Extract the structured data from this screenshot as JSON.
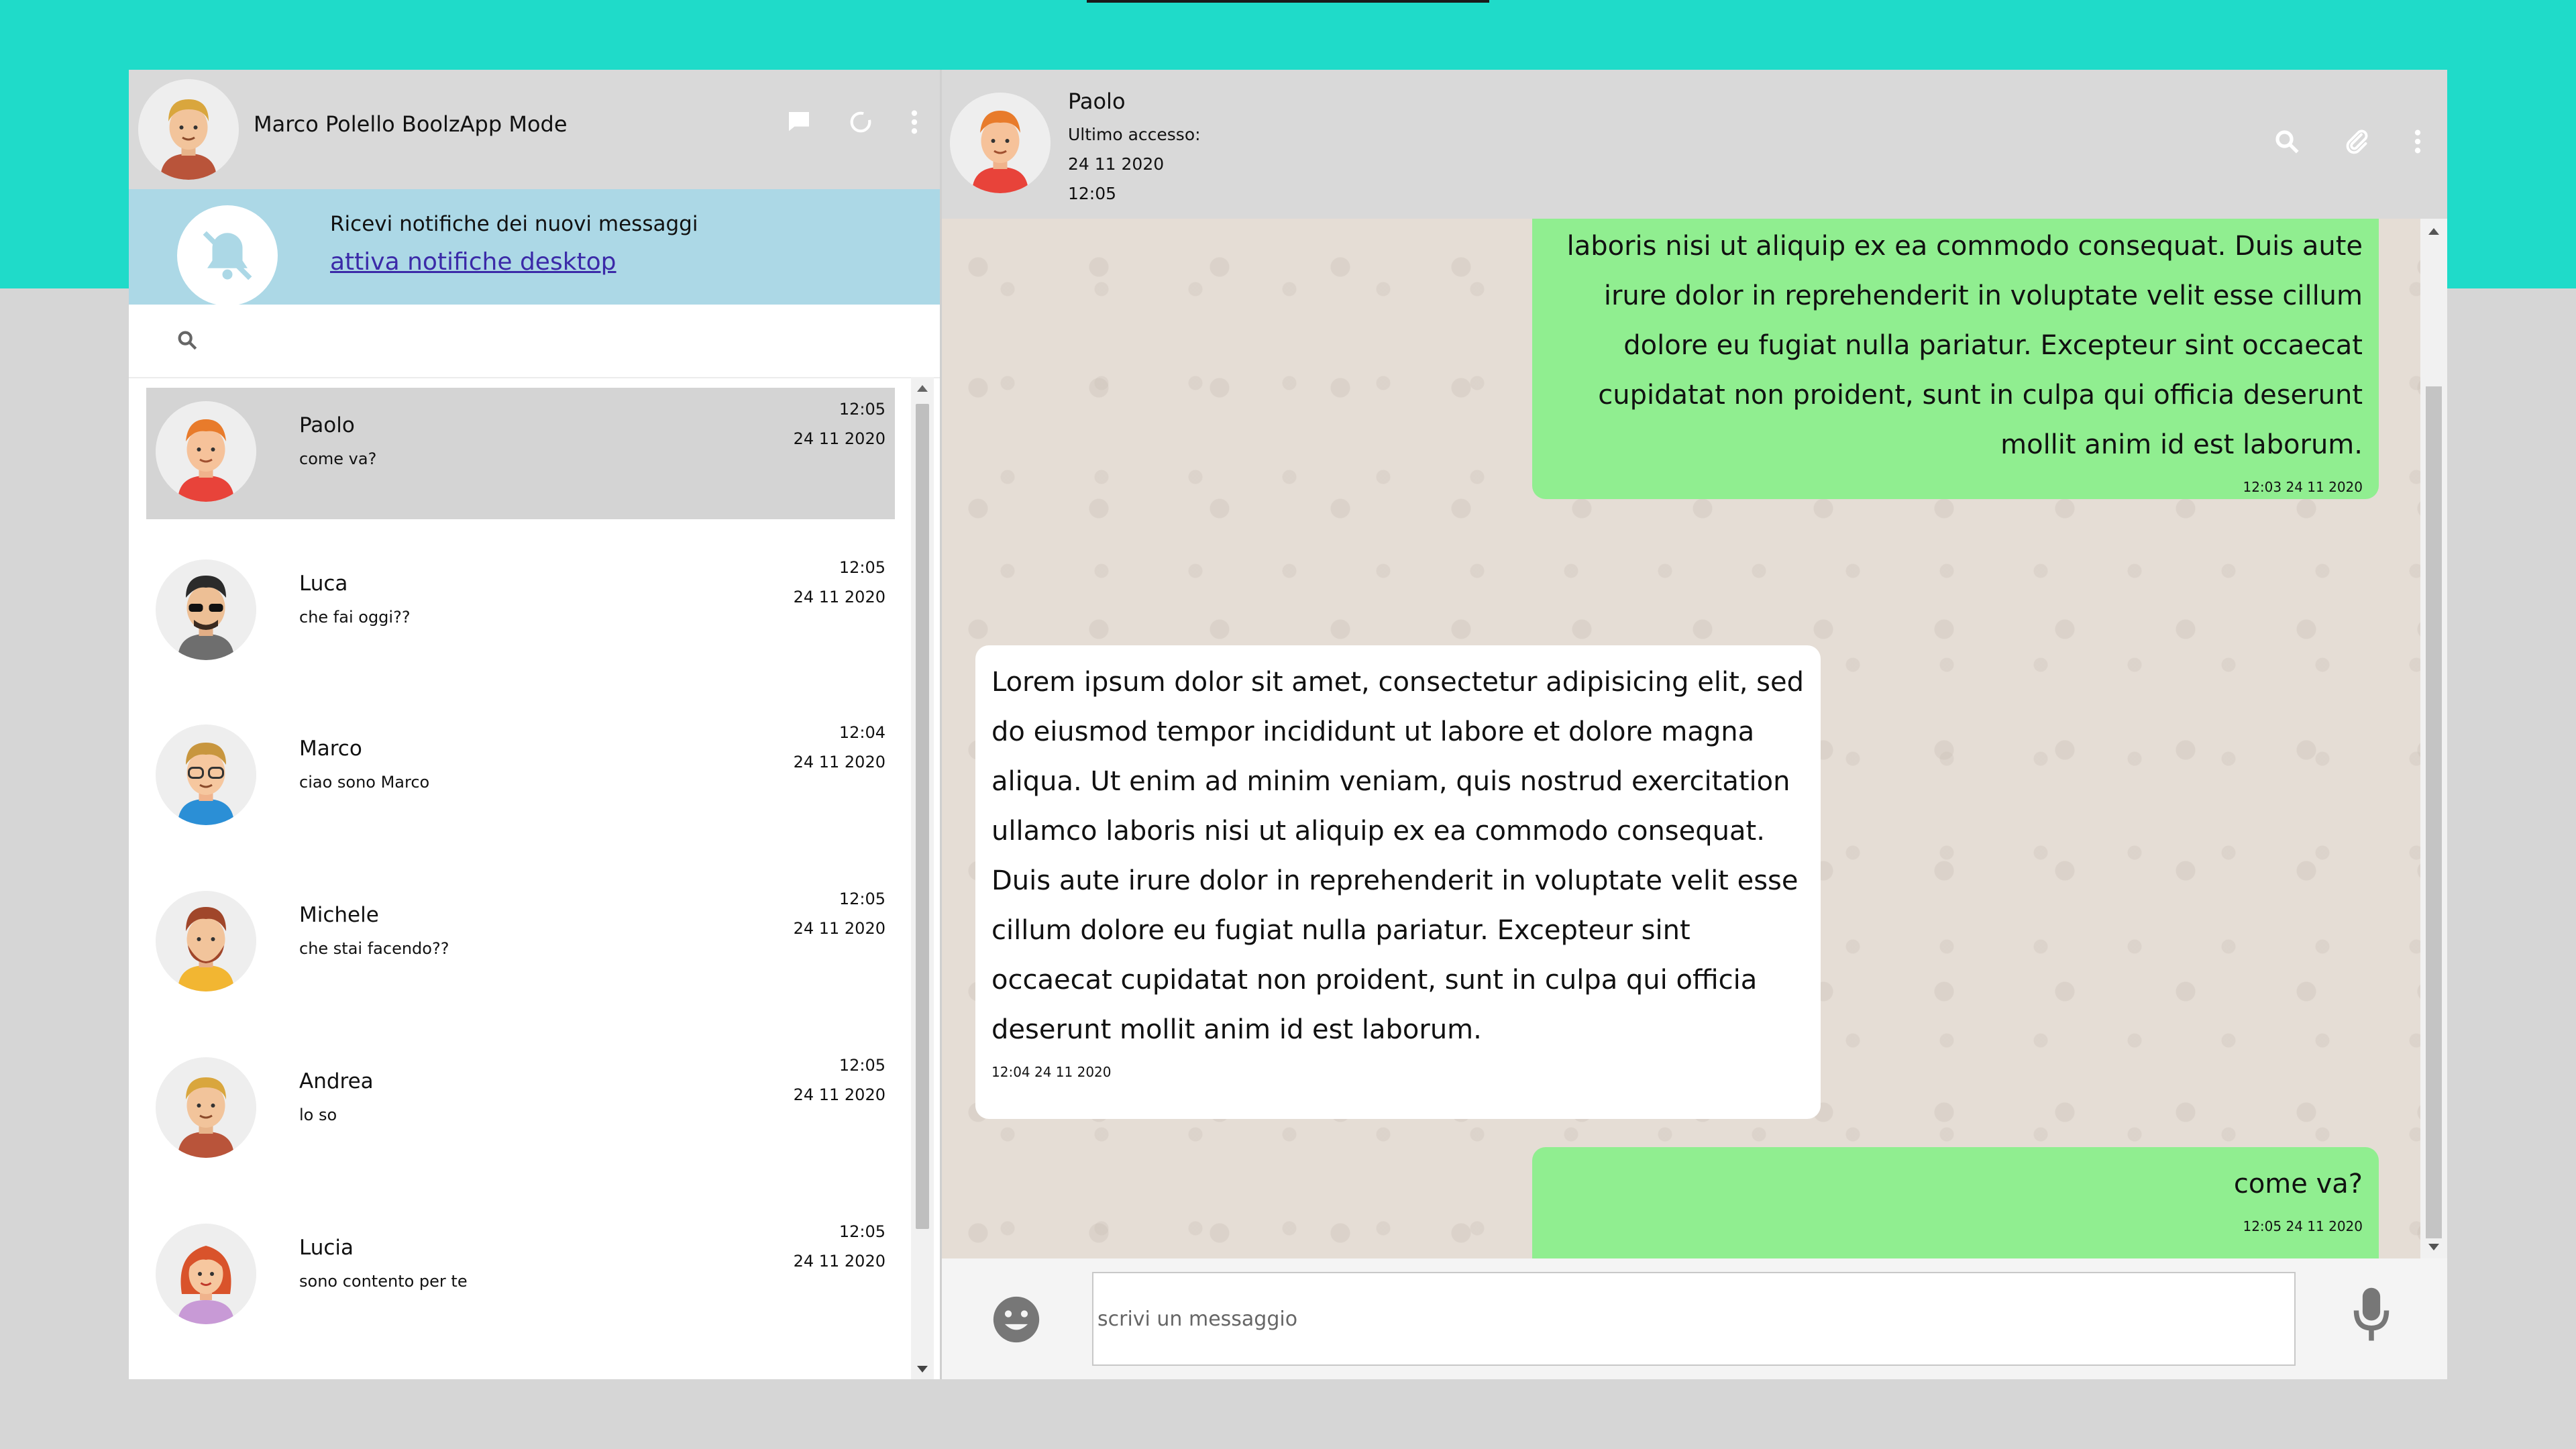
{
  "me": {
    "name": "Marco Polello BoolzApp Mode"
  },
  "header_icons": [
    "chat-icon",
    "status-icon",
    "menu-dots-icon"
  ],
  "notification": {
    "title": "Ricevi notifiche dei nuovi messaggi",
    "link": "attiva notifiche desktop"
  },
  "search": {
    "placeholder": ""
  },
  "contacts": [
    {
      "name": "Paolo",
      "last": "come va?",
      "time": "12:05",
      "date": "24 11 2020",
      "active": true
    },
    {
      "name": "Luca",
      "last": "che fai oggi??",
      "time": "12:05",
      "date": "24 11 2020"
    },
    {
      "name": "Marco",
      "last": "ciao sono Marco",
      "time": "12:04",
      "date": "24 11 2020"
    },
    {
      "name": "Michele",
      "last": "che stai facendo??",
      "time": "12:05",
      "date": "24 11 2020"
    },
    {
      "name": "Andrea",
      "last": "lo so",
      "time": "12:05",
      "date": "24 11 2020"
    },
    {
      "name": "Lucia",
      "last": "sono contento per te",
      "time": "12:05",
      "date": "24 11 2020"
    }
  ],
  "chat": {
    "name": "Paolo",
    "status_label": "Ultimo accesso:",
    "last_seen_date": "24 11 2020",
    "last_seen_time": "12:05",
    "messages": [
      {
        "type": "sent",
        "text": "enim ad minim veniam, quis nostrud exercitation ullamco laboris nisi ut aliquip ex ea commodo consequat. Duis aute irure dolor in reprehenderit in voluptate velit esse cillum dolore eu fugiat nulla pariatur. Excepteur sint occaecat cupidatat non proident, sunt in culpa qui officia deserunt mollit anim id est laborum.",
        "time": "12:03 24 11 2020"
      },
      {
        "type": "received",
        "text": "Lorem ipsum dolor sit amet, consectetur adipisicing elit, sed do eiusmod tempor incididunt ut labore et dolore magna aliqua. Ut enim ad minim veniam, quis nostrud exercitation ullamco laboris nisi ut aliquip ex ea commodo consequat. Duis aute irure dolor in reprehenderit in voluptate velit esse cillum dolore eu fugiat nulla pariatur. Excepteur sint occaecat cupidatat non proident, sunt in culpa qui officia deserunt mollit anim id est laborum.",
        "time": "12:04 24 11 2020"
      },
      {
        "type": "sent",
        "text": "come va?",
        "time": "12:05 24 11 2020"
      }
    ]
  },
  "composer": {
    "placeholder": "scrivi un messaggio"
  },
  "colors": {
    "accent": "#1fdbc9",
    "sent_bubble": "#90ee90",
    "notification_bg": "#acd8e6",
    "header_bg": "#d9d9d9",
    "chat_bg": "#e5ddd5"
  }
}
